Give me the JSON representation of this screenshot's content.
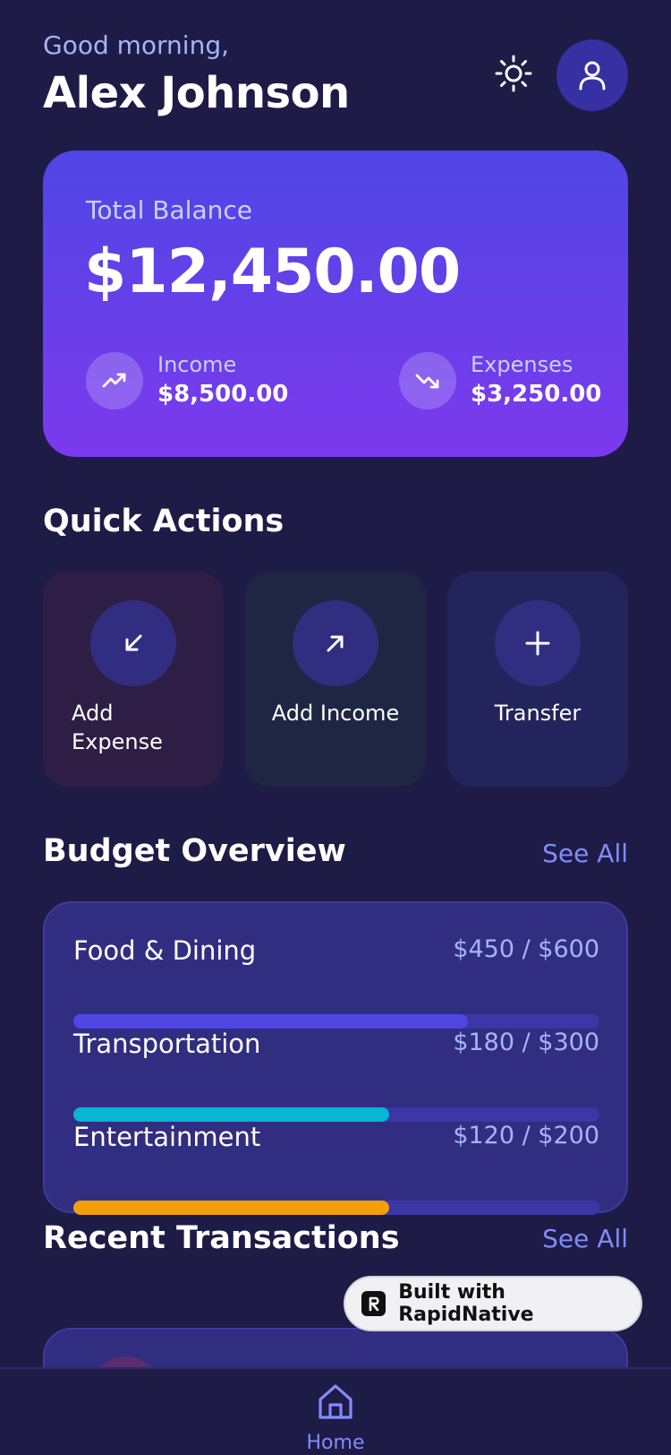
{
  "header": {
    "greeting": "Good morning,",
    "user_name": "Alex Johnson",
    "icons": {
      "theme": "sun-icon",
      "profile": "user-icon"
    }
  },
  "balance": {
    "label": "Total Balance",
    "amount": "$12,450.00",
    "income": {
      "label": "Income",
      "value": "$8,500.00",
      "icon": "trending-up-icon"
    },
    "expenses": {
      "label": "Expenses",
      "value": "$3,250.00",
      "icon": "trending-down-icon"
    }
  },
  "quick_actions": {
    "title": "Quick Actions",
    "items": [
      {
        "label": "Add Expense",
        "icon": "arrow-down-left-icon"
      },
      {
        "label": "Add Income",
        "icon": "arrow-up-right-icon"
      },
      {
        "label": "Transfer",
        "icon": "plus-icon"
      }
    ]
  },
  "budget": {
    "title": "Budget Overview",
    "see_all": "See All",
    "items": [
      {
        "name": "Food & Dining",
        "amount": "$450 / $600",
        "progress": 0.75,
        "color": "#4f46e5"
      },
      {
        "name": "Transportation",
        "amount": "$180 / $300",
        "progress": 0.6,
        "color": "#06b6d4"
      },
      {
        "name": "Entertainment",
        "amount": "$120 / $200",
        "progress": 0.6,
        "color": "#f59e0b"
      }
    ]
  },
  "transactions": {
    "title": "Recent Transactions",
    "see_all": "See All"
  },
  "badge": {
    "text": "Built with RapidNative"
  },
  "tab_bar": {
    "home_label": "Home",
    "home_icon": "home-icon"
  },
  "colors": {
    "background": "#1e1b47",
    "accent": "#4f46e5",
    "card": "#312e81",
    "muted_text": "#a5b4fc",
    "link": "#818cf8"
  }
}
